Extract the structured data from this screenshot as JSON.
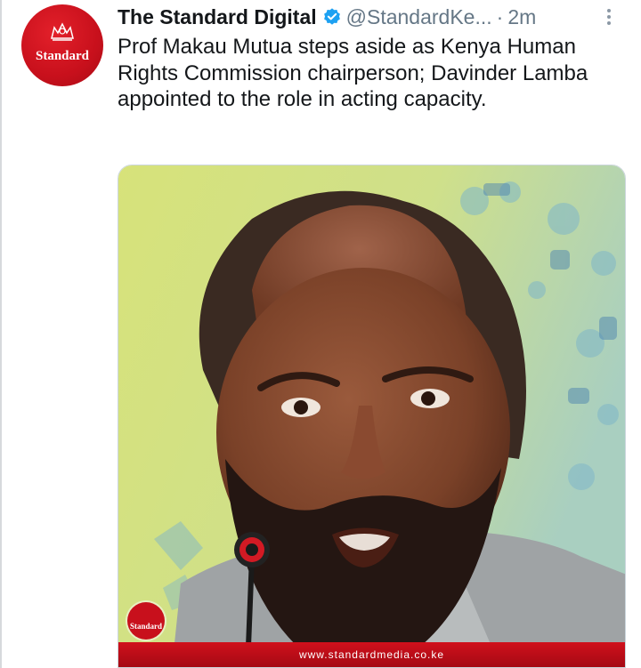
{
  "tweet": {
    "author": {
      "display_name": "The Standard Digital",
      "handle": "@StandardKe...",
      "verified": true,
      "avatar_text": "Standard",
      "avatar_color": "#c8101c"
    },
    "separator": "·",
    "timestamp": "2m",
    "text": "Prof Makau Mutua steps aside as Kenya Human Rights Commission chairperson; Davinder Lamba appointed to the role in acting capacity.",
    "media": {
      "watermark_text": "Standard",
      "source_url": "www.standardmedia.co.ke",
      "source_bar_color": "#c8101c"
    }
  },
  "icons": {
    "verified": "verified-badge-icon",
    "more": "more-options-icon"
  },
  "colors": {
    "text": "#14171a",
    "secondary": "#657786",
    "verified": "#1da1f2"
  }
}
